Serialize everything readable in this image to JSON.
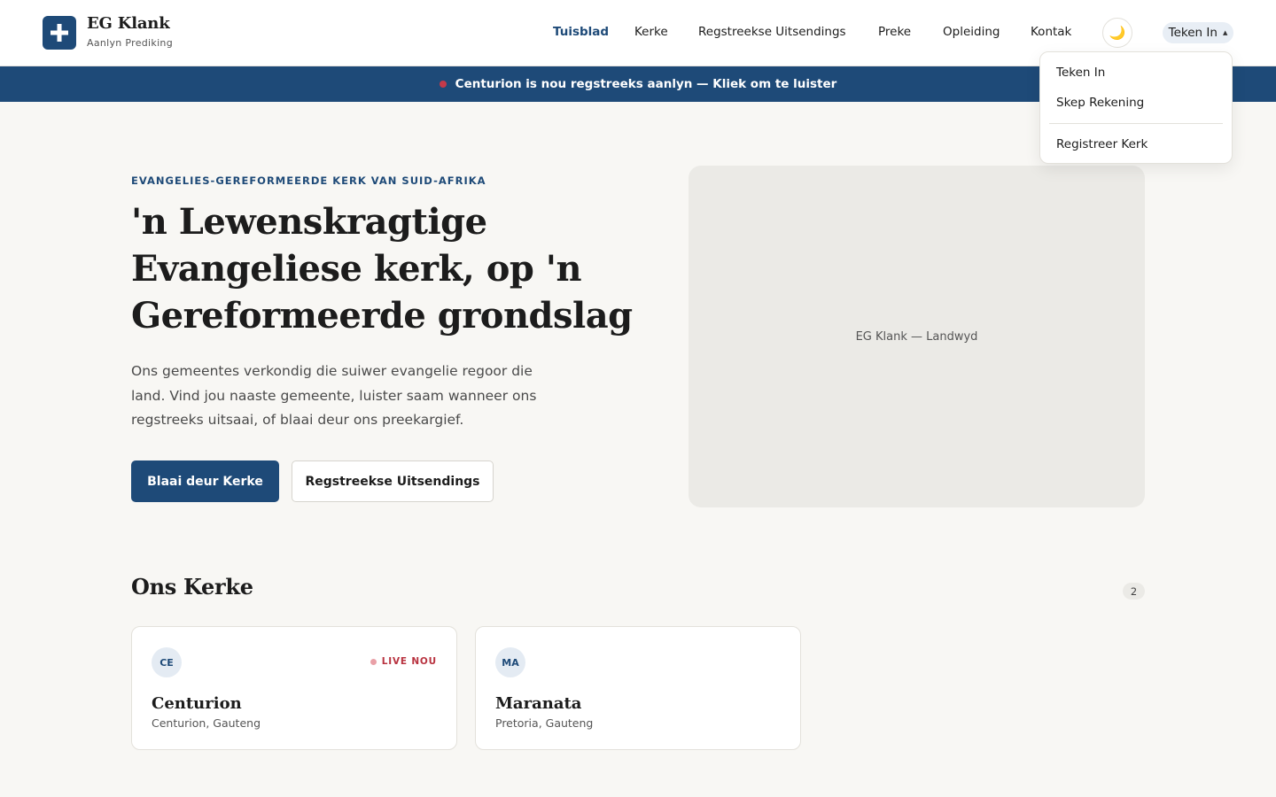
{
  "brand": {
    "title": "EG Klank",
    "subtitle": "Aanlyn Prediking"
  },
  "nav": {
    "items": [
      {
        "label": "Tuisblad",
        "active": true
      },
      {
        "label": "Kerke",
        "active": false
      },
      {
        "label": "Regstreekse Uitsendings",
        "active": false
      },
      {
        "label": "Preke",
        "active": false
      },
      {
        "label": "Opleiding",
        "active": false
      },
      {
        "label": "Kontak",
        "active": false
      }
    ],
    "theme_icon": "moon-icon",
    "signin_label": "Teken In"
  },
  "dropdown": {
    "items": [
      "Teken In",
      "Skep Rekening",
      "Registreer Kerk"
    ]
  },
  "banner": {
    "text": "Centurion is nou regstreeks aanlyn — Kliek om te luister"
  },
  "hero": {
    "eyebrow": "EVANGELIES-GEREFORMEERDE KERK VAN SUID-AFRIKA",
    "title": "'n Lewenskragtige Evangeliese kerk, op 'n Gereformeerde grondslag",
    "text": "Ons gemeentes verkondig die suiwer evangelie regoor die land. Vind jou naaste gemeente, luister saam wanneer ons regstreeks uitsaai, of blaai deur ons preekargief.",
    "primary_button": "Blaai deur Kerke",
    "secondary_button": "Regstreekse Uitsendings",
    "image_caption": "EG Klank — Landwyd"
  },
  "churches": {
    "title": "Ons Kerke",
    "count": "2",
    "cards": [
      {
        "initials": "CE",
        "name": "Centurion",
        "location": "Centurion, Gauteng",
        "live_label": "LIVE NOU"
      },
      {
        "initials": "MA",
        "name": "Maranata",
        "location": "Pretoria, Gauteng",
        "live_label": ""
      }
    ]
  },
  "colors": {
    "brand": "#1e4a78",
    "live": "#b8323f",
    "background": "#f8f7f4"
  }
}
